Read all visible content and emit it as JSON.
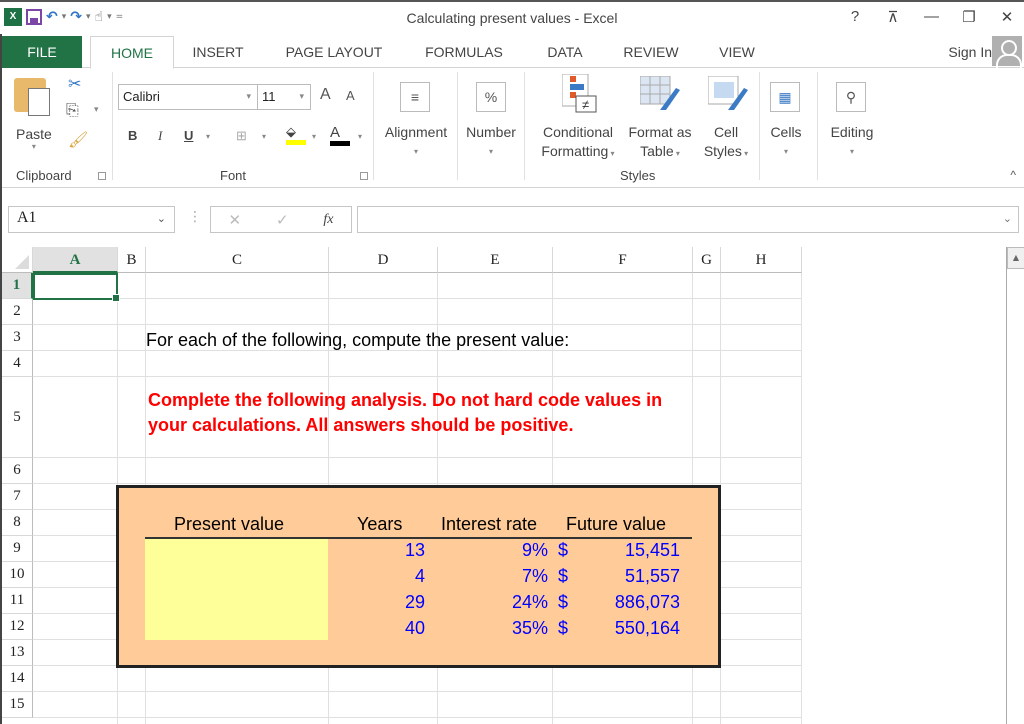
{
  "window": {
    "title": "Calculating present values - Excel",
    "controls": {
      "help": "?",
      "ribbon_display": "⊼",
      "minimize": "—",
      "restore": "❐",
      "close": "✕"
    }
  },
  "quick_access": {
    "app_icon": "X",
    "save": "save-icon",
    "undo": "↶",
    "redo": "↷",
    "touch": "touch-mode-icon",
    "customize": "="
  },
  "tabs": [
    {
      "label": "FILE"
    },
    {
      "label": "HOME"
    },
    {
      "label": "INSERT"
    },
    {
      "label": "PAGE LAYOUT"
    },
    {
      "label": "FORMULAS"
    },
    {
      "label": "DATA"
    },
    {
      "label": "REVIEW"
    },
    {
      "label": "VIEW"
    }
  ],
  "account": {
    "sign_in": "Sign In"
  },
  "ribbon": {
    "clipboard": {
      "label": "Clipboard",
      "paste": "Paste"
    },
    "font": {
      "label": "Font",
      "font_name": "Calibri",
      "font_size": "11",
      "bold": "B",
      "italic": "I",
      "underline": "U",
      "grow": "A",
      "shrink": "A",
      "font_color": "A"
    },
    "alignment": {
      "label": "Alignment",
      "icon": "≡"
    },
    "number": {
      "label": "Number",
      "icon": "%"
    },
    "styles": {
      "label": "Styles",
      "conditional_line1": "Conditional",
      "conditional_line2": "Formatting",
      "format_table_line1": "Format as",
      "format_table_line2": "Table",
      "cell_styles_line1": "Cell",
      "cell_styles_line2": "Styles"
    },
    "cells": {
      "label": "Cells"
    },
    "editing": {
      "label": "Editing"
    }
  },
  "formula_bar": {
    "name_box": "A1",
    "cancel": "✕",
    "enter": "✓",
    "fx": "fx",
    "formula": ""
  },
  "sheet": {
    "columns": [
      "A",
      "B",
      "C",
      "D",
      "E",
      "F",
      "G",
      "H"
    ],
    "rows": [
      "1",
      "2",
      "3",
      "4",
      "5",
      "6",
      "7",
      "8",
      "9",
      "10",
      "11",
      "12",
      "13",
      "14",
      "15"
    ],
    "active_cell": "A1",
    "intro": "For each of the following, compute the present value:",
    "instructions": "Complete the following analysis. Do not hard code values in your calculations. All answers should be positive.",
    "table": {
      "headers": {
        "present_value": "Present value",
        "years": "Years",
        "interest_rate": "Interest rate",
        "future_value": "Future value"
      },
      "rows": [
        {
          "present_value": "",
          "years": "13",
          "interest_rate": "9%",
          "currency": "$",
          "future_value": "15,451"
        },
        {
          "present_value": "",
          "years": "4",
          "interest_rate": "7%",
          "currency": "$",
          "future_value": "51,557"
        },
        {
          "present_value": "",
          "years": "29",
          "interest_rate": "24%",
          "currency": "$",
          "future_value": "886,073"
        },
        {
          "present_value": "",
          "years": "40",
          "interest_rate": "35%",
          "currency": "$",
          "future_value": "550,164"
        }
      ]
    }
  },
  "colors": {
    "excel_green": "#217346",
    "table_fill": "#ffcc99",
    "input_fill": "#ffff99",
    "warning_red": "#ff0000",
    "value_blue": "#0000ff"
  }
}
